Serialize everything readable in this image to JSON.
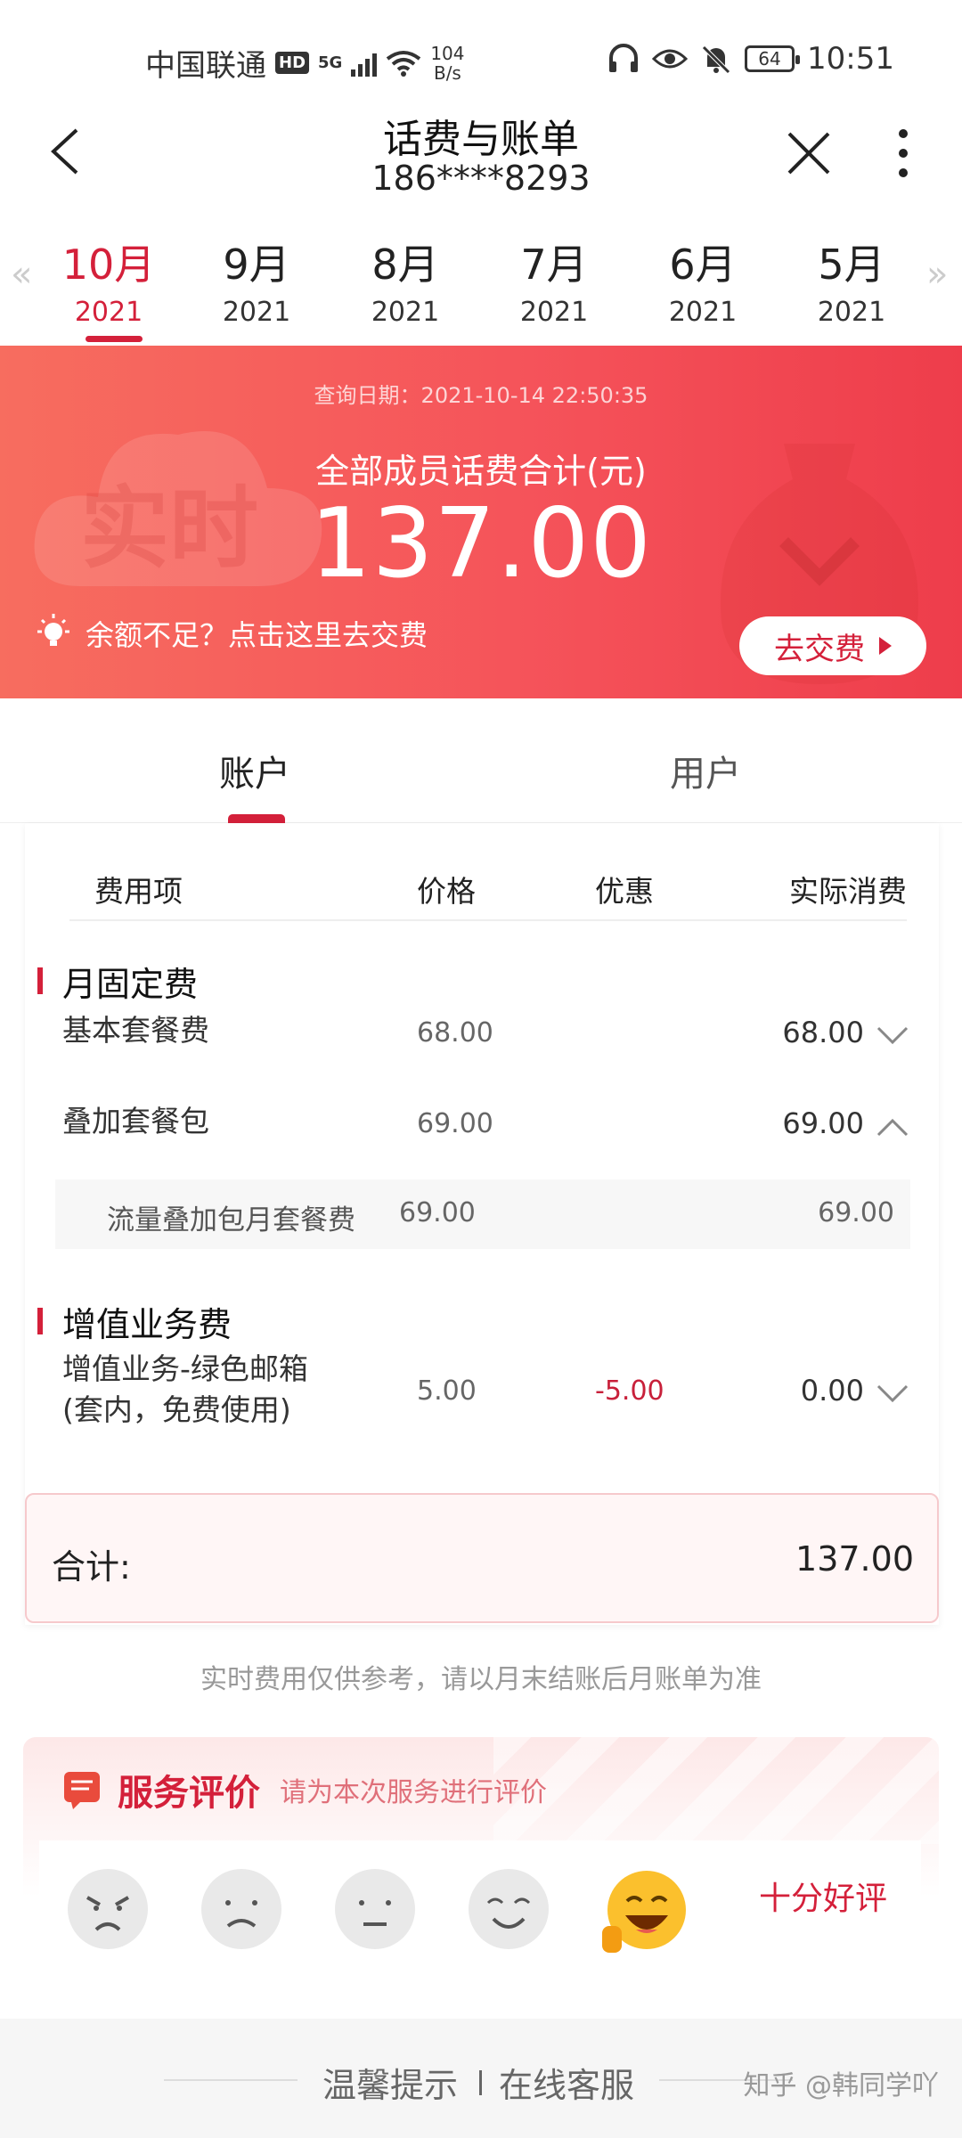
{
  "status_bar": {
    "carrier": "中国联通",
    "hd_badge": "HD",
    "network": "5G",
    "speed": "104",
    "speed_unit": "B/s",
    "battery": "64",
    "time": "10:51"
  },
  "header": {
    "title": "话费与账单",
    "phone": "186****8293"
  },
  "months": [
    {
      "month": "10月",
      "year": "2021",
      "active": true
    },
    {
      "month": "9月",
      "year": "2021"
    },
    {
      "month": "8月",
      "year": "2021"
    },
    {
      "month": "7月",
      "year": "2021"
    },
    {
      "month": "6月",
      "year": "2021"
    },
    {
      "month": "5月",
      "year": "2021"
    }
  ],
  "banner": {
    "query_date": "查询日期：2021-10-14 22:50:35",
    "cloud_text": "实时",
    "total_label": "全部成员话费合计(元)",
    "total_amount": "137.00",
    "tip": "余额不足？点击这里去交费",
    "pay_button": "去交费"
  },
  "segment_tabs": {
    "account": "账户",
    "user": "用户"
  },
  "table": {
    "headers": {
      "item": "费用项",
      "price": "价格",
      "discount": "优惠",
      "actual": "实际消费"
    },
    "sections": [
      {
        "title": "月固定费",
        "rows": [
          {
            "name": "基本套餐费",
            "price": "68.00",
            "discount": "",
            "actual": "68.00",
            "expanded": false
          },
          {
            "name": "叠加套餐包",
            "price": "69.00",
            "discount": "",
            "actual": "69.00",
            "expanded": true,
            "children": [
              {
                "name": "流量叠加包月套餐费",
                "price": "69.00",
                "actual": "69.00"
              }
            ]
          }
        ]
      },
      {
        "title": "增值业务费",
        "rows": [
          {
            "name": "增值业务-绿色邮箱(套内，免费使用)",
            "name_line1": "增值业务-绿色邮箱",
            "name_line2": "(套内，免费使用)",
            "price": "5.00",
            "discount": "-5.00",
            "actual": "0.00",
            "expanded": false
          }
        ]
      }
    ],
    "total_label": "合计:",
    "total_value": "137.00"
  },
  "note": "实时费用仅供参考，请以月末结账后月账单为准",
  "rating": {
    "title": "服务评价",
    "subtitle": "请为本次服务进行评价",
    "selected_label": "十分好评",
    "faces": [
      "angry-face-icon",
      "sad-face-icon",
      "neutral-face-icon",
      "smile-face-icon",
      "laughing-face-icon"
    ]
  },
  "bottom": {
    "tips": "温馨提示",
    "service": "在线客服",
    "watermark": "知乎 @韩同学吖"
  },
  "colors": {
    "accent": "#d4203a",
    "banner_start": "#f76d5f",
    "banner_end": "#ee3d4b"
  }
}
